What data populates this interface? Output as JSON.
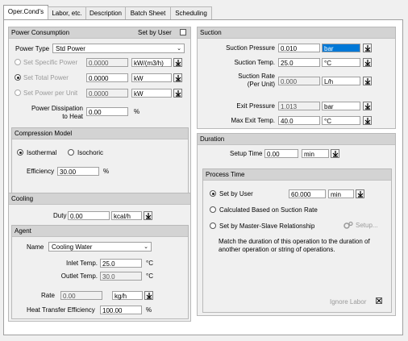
{
  "tabs": [
    "Oper.Cond's",
    "Labor, etc.",
    "Description",
    "Batch Sheet",
    "Scheduling"
  ],
  "power": {
    "title": "Power Consumption",
    "set_by_user": "Set by User",
    "power_type_label": "Power Type",
    "power_type_value": "Std Power",
    "specific_power_label": "Set Specific Power",
    "specific_power_value": "0.0000",
    "specific_power_unit": "kW/(m3/h)",
    "total_power_label": "Set Total Power",
    "total_power_value": "0.0000",
    "total_power_unit": "kW",
    "power_per_unit_label": "Set Power per Unit",
    "power_per_unit_value": "0.0000",
    "power_per_unit_unit": "kW",
    "dissipation_label": "Power Dissipation\nto Heat",
    "dissipation_value": "0.00",
    "dissipation_unit": "%"
  },
  "compression": {
    "title": "Compression Model",
    "isothermal": "Isothermal",
    "isochoric": "Isochoric",
    "efficiency_label": "Efficiency",
    "efficiency_value": "30.00",
    "efficiency_unit": "%"
  },
  "suction": {
    "title": "Suction",
    "pressure_label": "Suction Pressure",
    "pressure_value": "0.010",
    "pressure_unit": "bar",
    "temp_label": "Suction Temp.",
    "temp_value": "25.0",
    "temp_unit": "°C",
    "rate_label": "Suction Rate\n(Per Unit)",
    "rate_value": "0.000",
    "rate_unit": "L/h",
    "exit_pressure_label": "Exit Pressure",
    "exit_pressure_value": "1.013",
    "exit_pressure_unit": "bar",
    "max_exit_temp_label": "Max Exit Temp.",
    "max_exit_temp_value": "40.0",
    "max_exit_temp_unit": "°C"
  },
  "duration": {
    "title": "Duration",
    "setup_label": "Setup Time",
    "setup_value": "0.00",
    "setup_unit": "min"
  },
  "process_time": {
    "title": "Process Time",
    "set_by_user": "Set by User",
    "set_by_user_value": "60.000",
    "set_by_user_unit": "min",
    "calculated": "Calculated Based on Suction Rate",
    "master_slave": "Set by Master-Slave Relationship",
    "setup_button": "Setup...",
    "note": "Match the duration of this operation to the duration of another operation or string of operations.",
    "ignore_label": "Ignore Labor"
  },
  "cooling": {
    "title": "Cooling",
    "duty_label": "Duty",
    "duty_value": "0.00",
    "duty_unit": "kcal/h"
  },
  "agent": {
    "title": "Agent",
    "name_label": "Name",
    "name_value": "Cooling Water",
    "inlet_label": "Inlet Temp.",
    "inlet_value": "25.0",
    "inlet_unit": "°C",
    "outlet_label": "Outlet Temp.",
    "outlet_value": "30.0",
    "outlet_unit": "°C",
    "rate_label": "Rate",
    "rate_value": "0.00",
    "rate_unit": "kg/h",
    "efficiency_label": "Heat Transfer Efficiency",
    "efficiency_value": "100.00",
    "efficiency_unit": "%"
  }
}
